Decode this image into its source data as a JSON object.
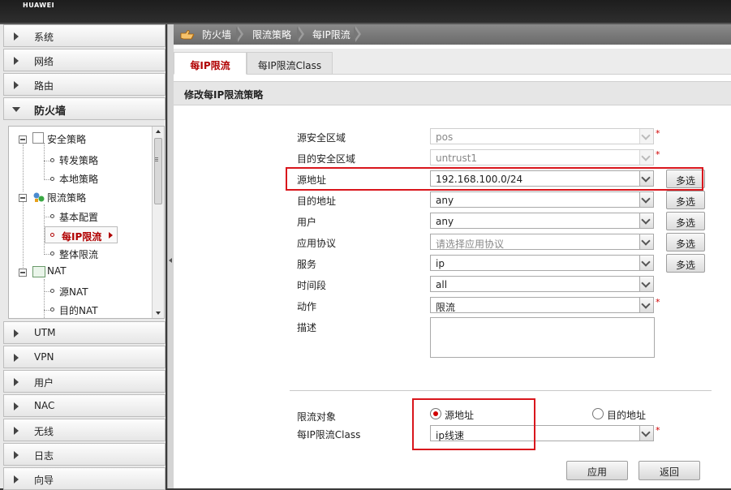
{
  "header": {
    "brand": "HUAWEI"
  },
  "sidebar": {
    "items": [
      {
        "label": "系统"
      },
      {
        "label": "网络"
      },
      {
        "label": "路由"
      },
      {
        "label": "防火墙"
      },
      {
        "label": "UTM"
      },
      {
        "label": "VPN"
      },
      {
        "label": "用户"
      },
      {
        "label": "NAC"
      },
      {
        "label": "无线"
      },
      {
        "label": "日志"
      },
      {
        "label": "向导"
      }
    ],
    "tree": {
      "security_policy": "安全策略",
      "forward_policy": "转发策略",
      "local_policy": "本地策略",
      "rate_limit_policy": "限流策略",
      "basic_config": "基本配置",
      "per_ip_limit": "每IP限流",
      "overall_limit": "整体限流",
      "nat": "NAT",
      "source_nat": "源NAT",
      "dest_nat": "目的NAT"
    }
  },
  "breadcrumb": {
    "items": [
      "防火墙",
      "限流策略",
      "每IP限流"
    ]
  },
  "tabs": [
    {
      "label": "每IP限流",
      "active": true
    },
    {
      "label": "每IP限流Class",
      "active": false
    }
  ],
  "section": {
    "title": "修改每IP限流策略"
  },
  "form": {
    "src_zone": {
      "label": "源安全区域",
      "value": "pos"
    },
    "dst_zone": {
      "label": "目的安全区域",
      "value": "untrust1"
    },
    "src_addr": {
      "label": "源地址",
      "value": "192.168.100.0/24"
    },
    "dst_addr": {
      "label": "目的地址",
      "value": "any"
    },
    "user": {
      "label": "用户",
      "value": "any"
    },
    "app_protocol": {
      "label": "应用协议",
      "placeholder": "请选择应用协议"
    },
    "service": {
      "label": "服务",
      "value": "ip"
    },
    "time_range": {
      "label": "时间段",
      "value": "all"
    },
    "action": {
      "label": "动作",
      "value": "限流"
    },
    "description": {
      "label": "描述",
      "value": ""
    },
    "multi_select_label": "多选",
    "required_mark": "*",
    "limit_target": {
      "label": "限流对象",
      "option_src": "源地址",
      "option_dst": "目的地址",
      "selected": "源地址"
    },
    "class": {
      "label": "每IP限流Class",
      "value": "ip线速"
    },
    "apply_label": "应用",
    "back_label": "返回"
  },
  "colors": {
    "accent": "#b00000",
    "highlight": "#d9161c",
    "required": "#d00000"
  }
}
